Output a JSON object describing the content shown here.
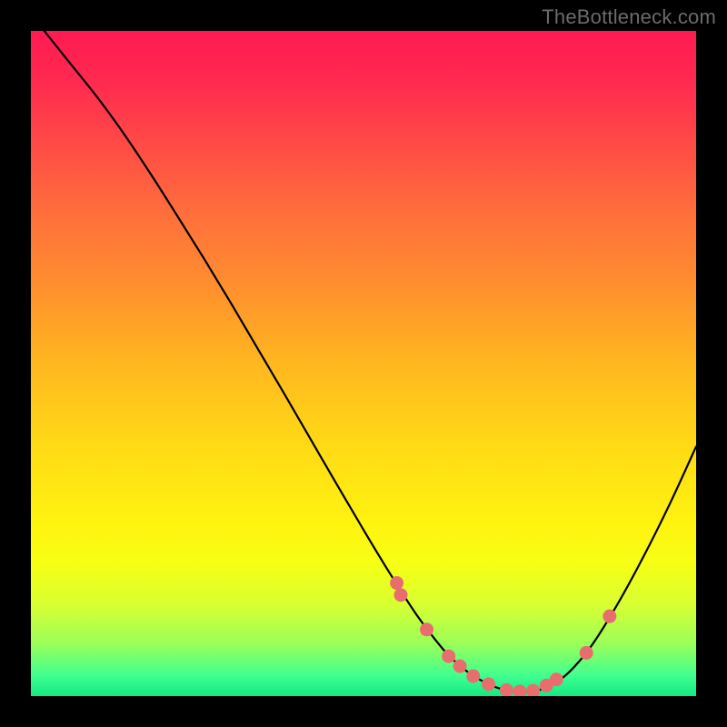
{
  "watermark": "TheBottleneck.com",
  "colors": {
    "background": "#000000",
    "curve_stroke": "#000000",
    "dot_fill": "#e86e6e",
    "gradient_stops": [
      "#ff1a52",
      "#ff4747",
      "#ff8e2f",
      "#ffd916",
      "#f7ff14",
      "#9cff58",
      "#14e884"
    ]
  },
  "chart_data": {
    "type": "line",
    "title": "",
    "xlabel": "",
    "ylabel": "",
    "xlim": [
      0,
      100
    ],
    "ylim": [
      0,
      100
    ],
    "grid": false,
    "legend": false,
    "series": [
      {
        "name": "bottleneck-curve",
        "x": [
          2,
          6,
          10,
          14,
          18,
          22,
          26,
          30,
          34,
          38,
          42,
          46,
          50,
          54,
          58,
          62,
          64,
          66,
          68,
          70,
          72,
          76,
          80,
          84,
          88,
          92,
          96,
          100
        ],
        "y": [
          100,
          95,
          90,
          84.5,
          78.5,
          72.2,
          65.8,
          59.2,
          52.4,
          45.6,
          38.7,
          31.8,
          25.0,
          18.4,
          12.2,
          7.0,
          5.0,
          3.4,
          2.2,
          1.3,
          0.8,
          0.8,
          2.8,
          7.2,
          13.5,
          20.8,
          28.8,
          37.5
        ]
      }
    ],
    "dots": {
      "name": "highlight-dots",
      "points": [
        {
          "x": 55.0,
          "y": 17.0
        },
        {
          "x": 55.6,
          "y": 15.2
        },
        {
          "x": 59.5,
          "y": 10.0
        },
        {
          "x": 62.8,
          "y": 6.0
        },
        {
          "x": 64.5,
          "y": 4.5
        },
        {
          "x": 66.5,
          "y": 3.0
        },
        {
          "x": 68.8,
          "y": 1.8
        },
        {
          "x": 71.5,
          "y": 0.9
        },
        {
          "x": 73.5,
          "y": 0.7
        },
        {
          "x": 75.5,
          "y": 0.8
        },
        {
          "x": 77.5,
          "y": 1.6
        },
        {
          "x": 79.0,
          "y": 2.5
        },
        {
          "x": 83.5,
          "y": 6.5
        },
        {
          "x": 87.0,
          "y": 12.0
        }
      ]
    }
  }
}
